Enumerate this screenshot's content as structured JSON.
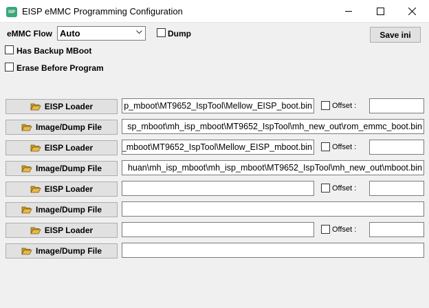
{
  "window": {
    "title": "EISP eMMC Programming Configuration",
    "icon_text": "ISP",
    "icons": {
      "app": "chip-icon",
      "minimize": "minimize-icon",
      "maximize": "maximize-icon",
      "close": "close-icon"
    }
  },
  "top": {
    "flow_label": "eMMC Flow",
    "flow_value": "Auto",
    "dump_label": "Dump",
    "save_label": "Save ini",
    "has_backup_label": "Has Backup MBoot",
    "erase_label": "Erase Before Program"
  },
  "rows": [
    {
      "type": "loader",
      "button": "EISP Loader",
      "path": "p_mboot\\MT9652_IspTool\\Mellow_EISP_boot.bin",
      "offset_label": "Offset :",
      "offset": ""
    },
    {
      "type": "image",
      "button": "Image/Dump File",
      "path": "sp_mboot\\mh_isp_mboot\\MT9652_IspTool\\mh_new_out\\rom_emmc_boot.bin"
    },
    {
      "type": "loader",
      "button": "EISP Loader",
      "path": "_mboot\\MT9652_IspTool\\Mellow_EISP_mboot.bin",
      "offset_label": "Offset :",
      "offset": ""
    },
    {
      "type": "image",
      "button": "Image/Dump File",
      "path": "huan\\mh_isp_mboot\\mh_isp_mboot\\MT9652_IspTool\\mh_new_out\\mboot.bin"
    },
    {
      "type": "loader",
      "button": "EISP Loader",
      "path": "",
      "offset_label": "Offset :",
      "offset": ""
    },
    {
      "type": "image",
      "button": "Image/Dump File",
      "path": ""
    },
    {
      "type": "loader",
      "button": "EISP Loader",
      "path": "",
      "offset_label": "Offset :",
      "offset": ""
    },
    {
      "type": "image",
      "button": "Image/Dump File",
      "path": ""
    }
  ],
  "colors": {
    "app_icon": "#3ca77a",
    "folder_icon": "#e8b84a"
  }
}
